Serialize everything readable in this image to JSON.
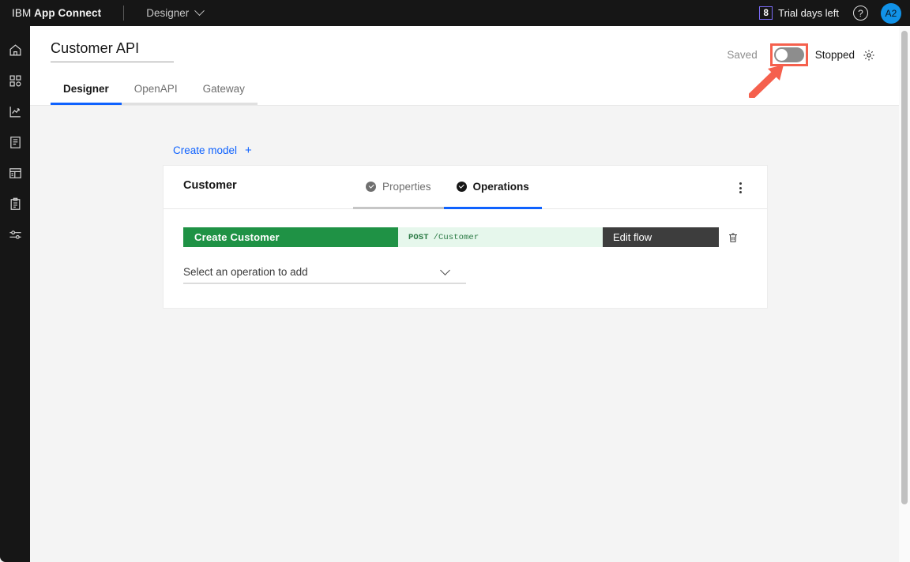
{
  "topnav": {
    "brand_prefix": "IBM ",
    "brand_name": "App Connect",
    "selector_label": "Designer",
    "trial_count": "8",
    "trial_label": "Trial days left",
    "help_glyph": "?",
    "avatar_initials": "A2"
  },
  "rail": {
    "items": [
      {
        "name": "home-icon",
        "label": "Home"
      },
      {
        "name": "apps-icon",
        "label": "Applications"
      },
      {
        "name": "chart-line-icon",
        "label": "Analytics"
      },
      {
        "name": "catalog-icon",
        "label": "Catalog"
      },
      {
        "name": "dashboard-icon",
        "label": "Dashboard"
      },
      {
        "name": "clipboard-icon",
        "label": "Logs"
      },
      {
        "name": "sliders-icon",
        "label": "Settings"
      }
    ]
  },
  "page": {
    "api_title": "Customer API",
    "tabs": [
      {
        "label": "Designer",
        "active": true
      },
      {
        "label": "OpenAPI",
        "active": false
      },
      {
        "label": "Gateway",
        "active": false
      }
    ],
    "saved_label": "Saved",
    "run_state_label": "Stopped",
    "toggle_state": "off",
    "gear_icon": "gear-icon"
  },
  "body": {
    "create_model_label": "Create model",
    "create_model_plus": "+",
    "card": {
      "title": "Customer",
      "tabs": [
        {
          "label": "Properties",
          "active": false
        },
        {
          "label": "Operations",
          "active": true
        }
      ],
      "operations": [
        {
          "name": "Create  Customer",
          "verb": "POST",
          "path": "/Customer",
          "edit_label": "Edit flow",
          "delete_icon": "trash-icon"
        }
      ],
      "add_operation_placeholder": "Select an operation to add"
    }
  },
  "annotation": {
    "highlight_color": "#f5604d",
    "arrow_color": "#f5604d",
    "target": "start-stop-toggle"
  }
}
